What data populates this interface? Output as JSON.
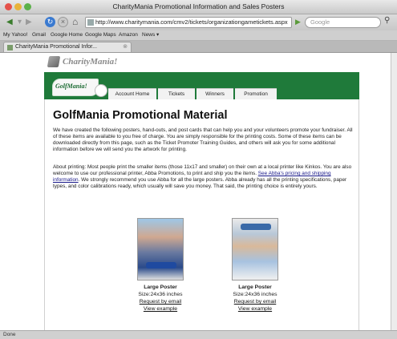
{
  "window": {
    "title": "CharityMania Promotional Information and Sales Posters"
  },
  "toolbar": {
    "url": "http://www.charitymania.com/cmv2/tickets/organizationgametickets.aspx",
    "search_placeholder": "Google"
  },
  "bookmarks": [
    "My Yahoo!",
    "Gmail",
    "Google Home",
    "Google Maps",
    "Amazon",
    "News ▾"
  ],
  "tab": {
    "label": "CharityMania Promotional Infor..."
  },
  "site": {
    "logo_text": "CharityMania!",
    "golf_logo_text": "GolfMania!",
    "nav": [
      "Account Home",
      "Tickets",
      "Winners",
      "Promotion"
    ]
  },
  "content": {
    "title": "GolfMania Promotional Material",
    "para1": "We have created the following posters, hand-outs, and post cards that can help you and your volunteers promote your fundraiser. All of these items are available to you free of charge. You are simply responsible for the printing costs. Some of these items can be downloaded directly from this page, such as the Ticket Promoter Training Guides, and others will ask you for some additional information before we will send you the artwork for printing.",
    "para2_a": "About printing: Most people print the smaller items (those 11x17 and smaller) on their own at a local printer like Kinkos. You are also welcome to use our professional printer, Abba Promotions, to print and ship you the items.",
    "para2_link": "See Abba's pricing and shipping information",
    "para2_b": ". We strongly recommend you use Abba for all the large posters. Abba already has all the printing specifications, paper types, and color calibrations ready, which usually will save you money. That said, the printing choice is entirely yours."
  },
  "posters": [
    {
      "title": "Large Poster",
      "size": "Size:24x36 inches",
      "request_label": "Request by email",
      "view_label": "View example"
    },
    {
      "title": "Large Poster",
      "size": "Size:24x36 inches",
      "request_label": "Request by email",
      "view_label": "View example"
    }
  ],
  "status": {
    "text": "Done"
  }
}
